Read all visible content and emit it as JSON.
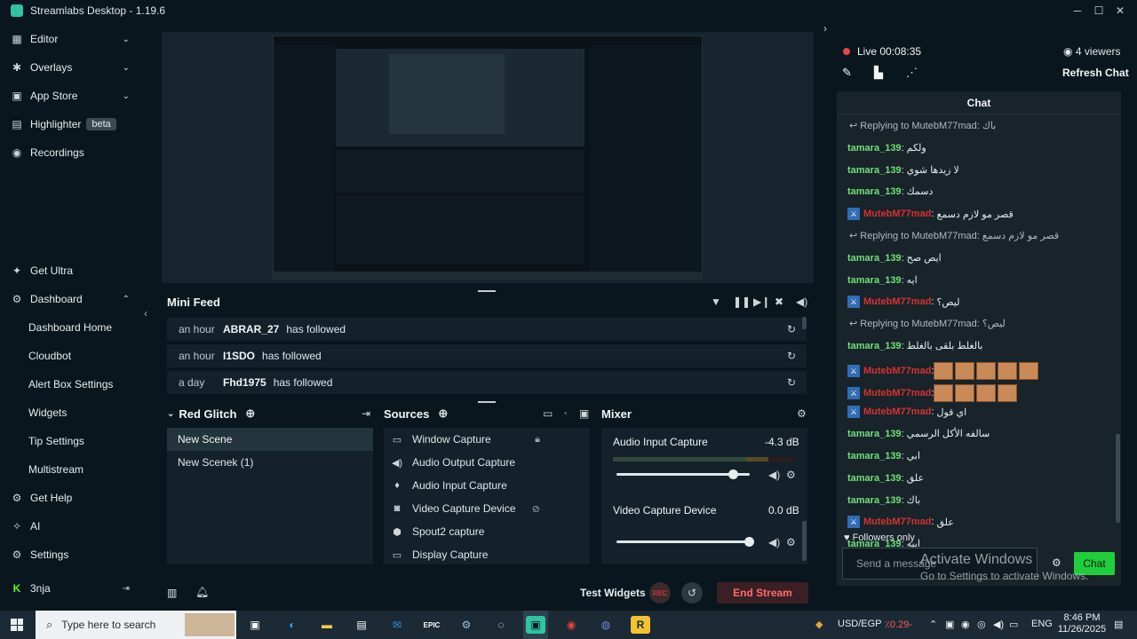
{
  "window": {
    "title": "Streamlabs Desktop - 1.19.6"
  },
  "sidebar": {
    "items": [
      {
        "label": "Editor",
        "icon": "editor-icon"
      },
      {
        "label": "Overlays",
        "icon": "overlays-icon"
      },
      {
        "label": "App Store",
        "icon": "app-store-icon"
      },
      {
        "label": "Highlighter",
        "icon": "highlighter-icon",
        "badge": "beta"
      },
      {
        "label": "Recordings",
        "icon": "recordings-icon"
      }
    ],
    "bottom_items": {
      "get_ultra": "Get Ultra",
      "dashboard": "Dashboard",
      "dashboard_sub": [
        "Dashboard Home",
        "Cloudbot",
        "Alert Box Settings",
        "Widgets",
        "Tip Settings",
        "Multistream"
      ],
      "get_help": "Get Help",
      "ai": "AI",
      "settings": "Settings",
      "user": "3nja"
    }
  },
  "minifeed": {
    "title": "Mini Feed",
    "rows": [
      {
        "time": "an hour",
        "user": "ABRAR_27",
        "action": "has followed"
      },
      {
        "time": "an hour",
        "user": "I1SDO",
        "action": "has followed"
      },
      {
        "time": "a day",
        "user": "Fhd1975",
        "action": "has followed"
      }
    ]
  },
  "scenes": {
    "title": "Red Glitch",
    "items": [
      "New Scene",
      "New Scenek (1)"
    ]
  },
  "sources": {
    "title": "Sources",
    "items": [
      "Window Capture",
      "Audio Output Capture",
      "Audio Input Capture",
      "Video Capture Device",
      "Spout2 capture",
      "Display Capture"
    ]
  },
  "mixer": {
    "title": "Mixer",
    "channels": [
      {
        "name": "Audio Input Capture",
        "db": "-4.3 dB",
        "level": 0.88
      },
      {
        "name": "Video Capture Device",
        "db": "0.0 dB",
        "level": 1.0
      }
    ]
  },
  "footer": {
    "test_widgets": "Test Widgets",
    "rec": "REC",
    "end_stream": "End Stream"
  },
  "chat": {
    "live_label": "Live 00:08:35",
    "viewers": "4 viewers",
    "refresh": "Refresh Chat",
    "header": "Chat",
    "followers_only": "Followers only",
    "input_placeholder": "Send a message",
    "send": "Chat",
    "messages": [
      {
        "kind": "reply",
        "text": "Replying to MutebM77mad: باك"
      },
      {
        "kind": "msg",
        "user": "tamara_139",
        "color": "green",
        "text": "ولكم"
      },
      {
        "kind": "msg",
        "user": "tamara_139",
        "color": "green",
        "text": "لا زيدها شوي"
      },
      {
        "kind": "msg",
        "user": "tamara_139",
        "color": "green",
        "text": "دسمك"
      },
      {
        "kind": "msg",
        "user": "MutebM77mad",
        "color": "red",
        "text": "قصر مو لازم دسمع"
      },
      {
        "kind": "reply",
        "text": "Replying to MutebM77mad: قصر مو لازم دسمع"
      },
      {
        "kind": "msg",
        "user": "tamara_139",
        "color": "green",
        "text": "ايص صح"
      },
      {
        "kind": "msg",
        "user": "tamara_139",
        "color": "green",
        "text": "ايه"
      },
      {
        "kind": "msg",
        "user": "MutebM77mad",
        "color": "red",
        "text": "ليص؟"
      },
      {
        "kind": "reply",
        "text": "Replying to MutebM77mad: ليص؟"
      },
      {
        "kind": "msg",
        "user": "tamara_139",
        "color": "green",
        "text": "بالغلط بلقى بالغلط"
      },
      {
        "kind": "msg",
        "user": "MutebM77mad",
        "color": "red",
        "text": "",
        "emotes": 5
      },
      {
        "kind": "msg",
        "user": "MutebM77mad",
        "color": "red",
        "text": "",
        "emotes": 4
      },
      {
        "kind": "msg",
        "user": "MutebM77mad",
        "color": "red",
        "text": "اي قول"
      },
      {
        "kind": "msg",
        "user": "tamara_139",
        "color": "green",
        "text": "سالفه الأكل الرسمي"
      },
      {
        "kind": "msg",
        "user": "tamara_139",
        "color": "green",
        "text": "ابي"
      },
      {
        "kind": "msg",
        "user": "tamara_139",
        "color": "green",
        "text": "علق"
      },
      {
        "kind": "msg",
        "user": "tamara_139",
        "color": "green",
        "text": "باك"
      },
      {
        "kind": "msg",
        "user": "MutebM77mad",
        "color": "red",
        "text": "علق"
      },
      {
        "kind": "msg",
        "user": "tamara_139",
        "color": "green",
        "text": "اييه"
      }
    ]
  },
  "watermark": {
    "line1": "Activate Windows",
    "line2": "Go to Settings to activate Windows."
  },
  "taskbar": {
    "search_placeholder": "Type here to search",
    "ticker": "USD/EGP",
    "ticker_value": "٪0.29-",
    "lang": "ENG",
    "time": "8:46 PM",
    "date": "11/26/2025"
  },
  "colors": {
    "accent": "#31c3a2",
    "live": "#e54646",
    "chat_green": "#6fe07a",
    "chat_red": "#d83131"
  }
}
